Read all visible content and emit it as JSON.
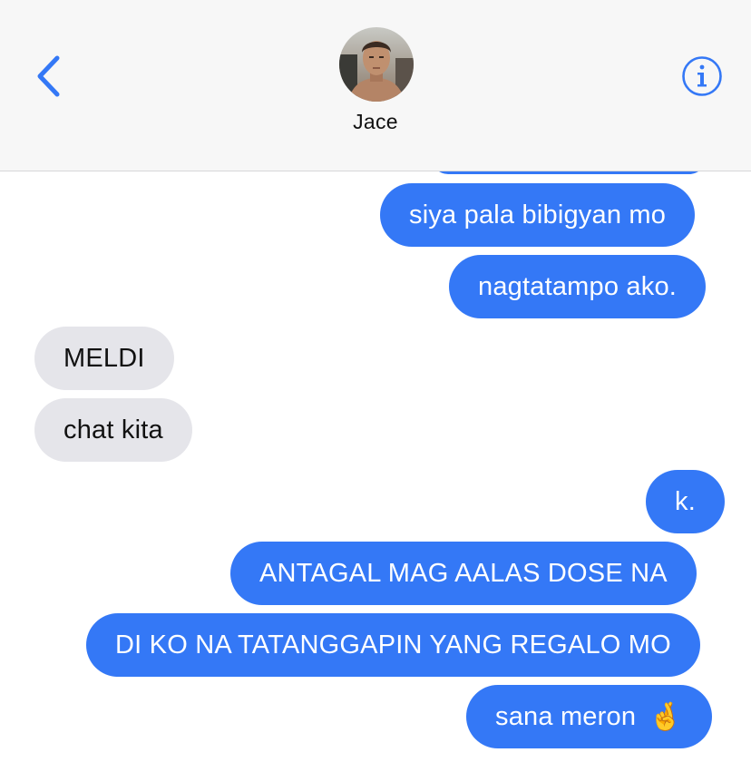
{
  "header": {
    "back_icon": "chevron-left-icon",
    "contact_name": "Jace",
    "info_icon": "info-circle-icon"
  },
  "colors": {
    "accent": "#3478f6",
    "outgoing_bubble": "#3478f6",
    "incoming_bubble": "#e5e5ea",
    "header_bg": "#f7f7f7"
  },
  "messages": [
    {
      "direction": "outgoing",
      "text": "siya pala bibigyan mo"
    },
    {
      "direction": "outgoing",
      "text": "nagtatampo ako."
    },
    {
      "direction": "incoming",
      "text": "MELDI"
    },
    {
      "direction": "incoming",
      "text": "chat kita"
    },
    {
      "direction": "outgoing",
      "text": "k."
    },
    {
      "direction": "outgoing",
      "text": "ANTAGAL MAG AALAS DOSE NA"
    },
    {
      "direction": "outgoing",
      "text": "DI KO NA TATANGGAPIN YANG REGALO MO"
    },
    {
      "direction": "outgoing",
      "text": "sana meron",
      "emoji": "🤞"
    }
  ]
}
